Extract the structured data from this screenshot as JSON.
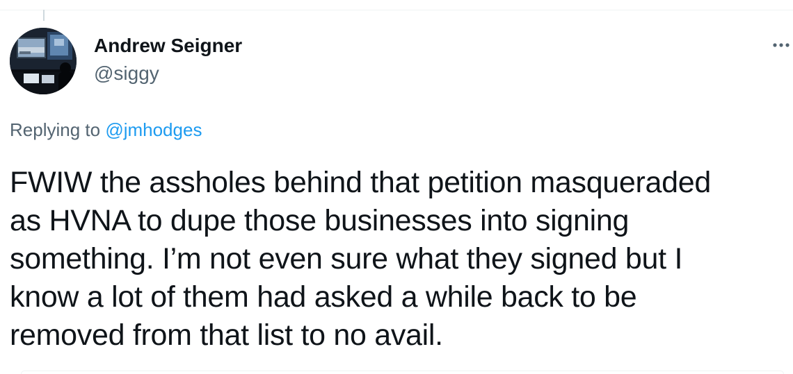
{
  "tweet": {
    "author": {
      "display_name": "Andrew Seigner",
      "handle": "@siggy",
      "avatar_icon": "avatar-image"
    },
    "more_icon": "more-dots-icon",
    "reply_context": {
      "prefix": "Replying to ",
      "mention": "@jmhodges"
    },
    "text_lines": [
      "FWIW the assholes behind that petition masqueraded",
      "as HVNA to dupe those businesses into signing",
      "something. I’m not even sure what they signed but I",
      "know a lot of them had asked a while back to be",
      "removed from that list to no avail."
    ]
  },
  "colors": {
    "text_primary": "#0f1419",
    "text_secondary": "#536471",
    "link": "#1d9bf0",
    "border": "#eff3f4"
  }
}
